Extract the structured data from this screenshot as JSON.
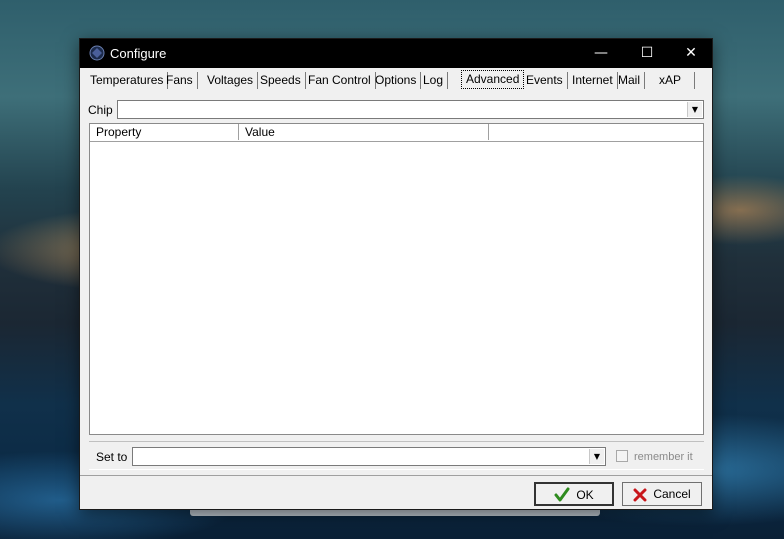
{
  "window": {
    "title": "Configure",
    "icon": "app-icon"
  },
  "titlebar": {
    "minimize": "—",
    "maximize": "☐",
    "close": "✕"
  },
  "tabs": [
    {
      "label": "Temperatures"
    },
    {
      "label": "Fans"
    },
    {
      "label": "Voltages"
    },
    {
      "label": "Speeds"
    },
    {
      "label": "Fan Control"
    },
    {
      "label": "Options"
    },
    {
      "label": "Log"
    },
    {
      "label": "Advanced",
      "active": true
    },
    {
      "label": "Events"
    },
    {
      "label": "Internet"
    },
    {
      "label": "Mail"
    },
    {
      "label": "xAP"
    }
  ],
  "chip": {
    "label": "Chip",
    "value": ""
  },
  "list": {
    "columns": [
      "Property",
      "Value",
      ""
    ]
  },
  "set_to": {
    "label": "Set to",
    "value": ""
  },
  "remember": {
    "label": "remember it",
    "checked": false,
    "enabled": false
  },
  "buttons": {
    "ok": "OK",
    "cancel": "Cancel"
  },
  "colors": {
    "titlebar": "#000000",
    "ok_check": "#2e8b1e",
    "cancel_x": "#c8161b"
  }
}
